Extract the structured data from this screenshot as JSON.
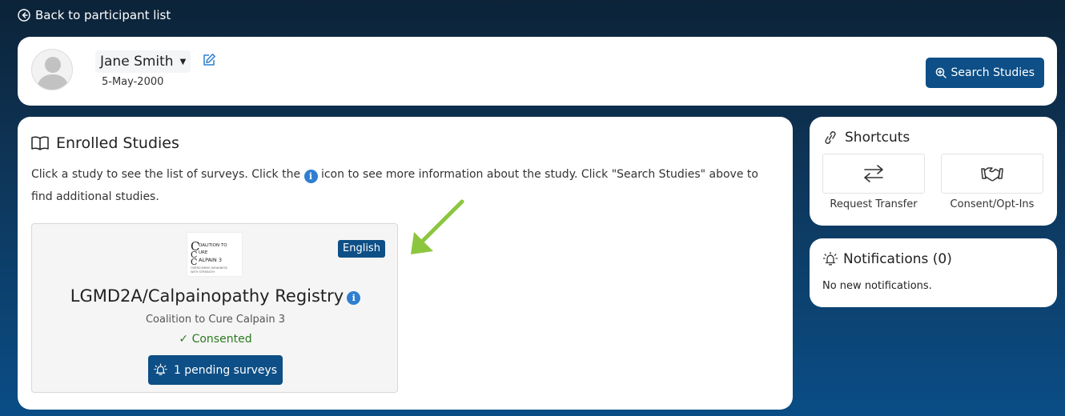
{
  "nav": {
    "back_label": "Back to participant list"
  },
  "participant": {
    "name": "Jane Smith",
    "dob": "5-May-2000"
  },
  "header": {
    "search_label": "Search Studies"
  },
  "enrolled": {
    "title": "Enrolled Studies",
    "instructions_pre": "Click a study to see the list of surveys. Click the ",
    "instructions_post": " icon to see more information about the study. Click \"Search Studies\" above to find additional studies.",
    "info_glyph": "i",
    "study": {
      "logo_lines": [
        "OALITION TO",
        "URE",
        "ALPAIN 3",
        "OVERCOMING WEAKNESS",
        "WITH STRENGTH"
      ],
      "language": "English",
      "title": "LGMD2A/Calpainopathy Registry",
      "organization": "Coalition to Cure Calpain 3",
      "status": "Consented",
      "status_glyph": "✓",
      "pending_label": "1 pending surveys"
    }
  },
  "shortcuts": {
    "title": "Shortcuts",
    "items": [
      {
        "label": "Request Transfer",
        "icon": "transfer-arrows-icon"
      },
      {
        "label": "Consent/Opt-Ins",
        "icon": "handshake-icon"
      }
    ]
  },
  "notifications": {
    "title": "Notifications (0)",
    "empty_text": "No new notifications."
  },
  "colors": {
    "primary": "#0d4f86",
    "info": "#2f7fd0",
    "success": "#2b7a1e",
    "annotation_arrow": "#8cc63f"
  }
}
